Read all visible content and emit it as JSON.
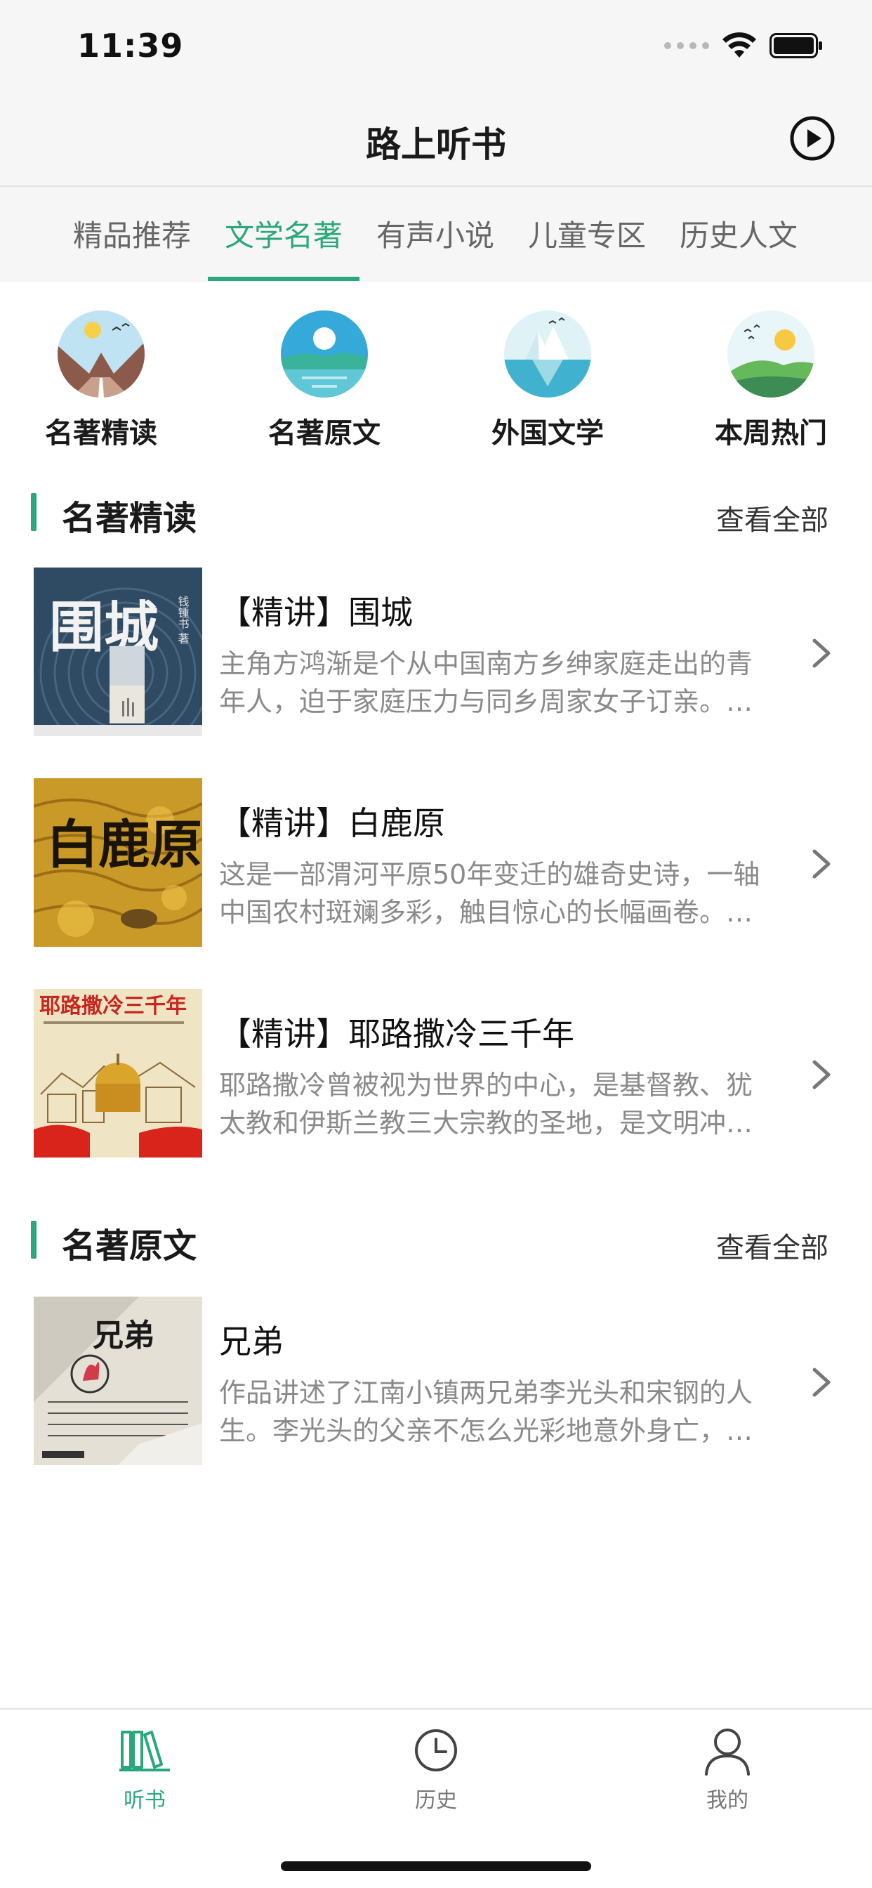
{
  "status": {
    "time": "11:39"
  },
  "nav": {
    "title": "路上听书",
    "play_icon": "play-circle-icon"
  },
  "tabs": [
    {
      "label": "精品推荐",
      "active": false
    },
    {
      "label": "文学名著",
      "active": true
    },
    {
      "label": "有声小说",
      "active": false
    },
    {
      "label": "儿童专区",
      "active": false
    },
    {
      "label": "历史人文",
      "active": false
    }
  ],
  "categories": [
    {
      "label": "名著精读",
      "icon": "road-landscape-icon"
    },
    {
      "label": "名著原文",
      "icon": "lake-landscape-icon"
    },
    {
      "label": "外国文学",
      "icon": "iceberg-icon"
    },
    {
      "label": "本周热门",
      "icon": "hills-landscape-icon"
    }
  ],
  "sections": [
    {
      "title": "名著精读",
      "more": "查看全部",
      "books": [
        {
          "title": "【精讲】围城",
          "desc": "主角方鸿渐是个从中国南方乡绅家庭走出的青年人，迫于家庭压力与同乡周家女子订亲。…"
        },
        {
          "title": "【精讲】白鹿原",
          "desc": "这是一部渭河平原50年变迁的雄奇史诗，一轴中国农村斑斓多彩，触目惊心的长幅画卷。…"
        },
        {
          "title": "【精讲】耶路撒冷三千年",
          "desc": "耶路撒冷曾被视为世界的中心，是基督教、犹太教和伊斯兰教三大宗教的圣地，是文明冲…"
        }
      ]
    },
    {
      "title": "名著原文",
      "more": "查看全部",
      "books": [
        {
          "title": "兄弟",
          "desc": "作品讲述了江南小镇两兄弟李光头和宋钢的人生。李光头的父亲不怎么光彩地意外身亡，…"
        }
      ]
    }
  ],
  "covers": [
    {
      "text": "围城",
      "sub": "钱锺书 著"
    },
    {
      "text": "白鹿原"
    },
    {
      "text": "耶路撒冷三千年"
    },
    {
      "text": "兄弟"
    }
  ],
  "tabbar": [
    {
      "label": "听书",
      "icon": "books-icon",
      "active": true
    },
    {
      "label": "历史",
      "icon": "clock-icon",
      "active": false
    },
    {
      "label": "我的",
      "icon": "person-icon",
      "active": false
    }
  ],
  "colors": {
    "accent": "#2aa87b",
    "bg_header": "#f6f6f6",
    "desc_text": "#8a8a8a"
  }
}
